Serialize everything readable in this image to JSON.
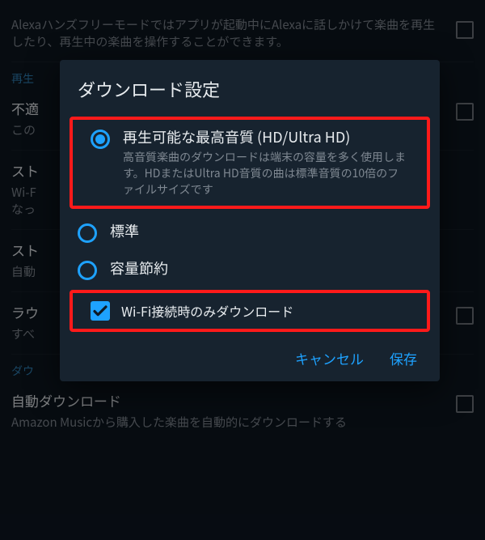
{
  "bg": {
    "intro": "Alexaハンズフリーモードではアプリが起動中にAlexaに話しかけて楽曲を再生したり、再生中の楽曲を操作することができます。",
    "section1": "再生",
    "item1_title": "不適",
    "item1_desc": "この",
    "item2_title": "スト",
    "item2_desc_a": "Wi-F",
    "item2_desc_b": "なっ",
    "item3_title": "スト",
    "item3_desc": "自動",
    "item4_title": "ラウ",
    "item4_desc": "すべ",
    "section2": "ダウ",
    "item5_title": "自動ダウンロード",
    "item5_desc": "Amazon Musicから購入した楽曲を自動的にダウンロードする"
  },
  "dialog": {
    "title": "ダウンロード設定",
    "opt1_label": "再生可能な最高音質 (HD/Ultra HD)",
    "opt1_sub": "高音質楽曲のダウンロードは端末の容量を多く使用します。HDまたはUltra HD音質の曲は標準音質の10倍のファイルサイズです",
    "opt2_label": "標準",
    "opt3_label": "容量節約",
    "wifi_label": "Wi-Fi接続時のみダウンロード",
    "cancel": "キャンセル",
    "save": "保存"
  }
}
